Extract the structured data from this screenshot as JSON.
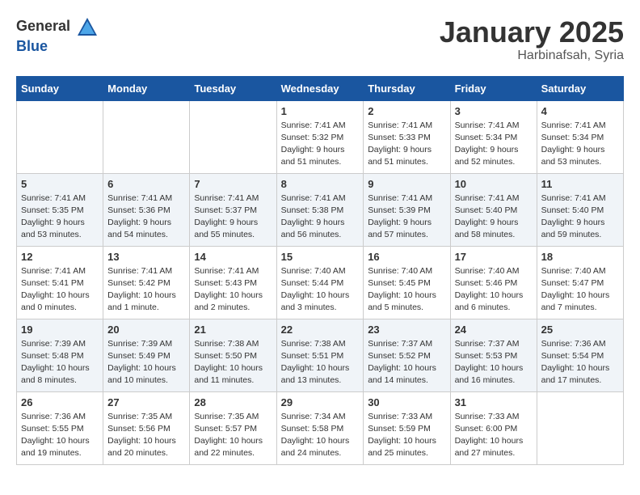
{
  "header": {
    "logo_general": "General",
    "logo_blue": "Blue",
    "month": "January 2025",
    "location": "Harbinafsah, Syria"
  },
  "weekdays": [
    "Sunday",
    "Monday",
    "Tuesday",
    "Wednesday",
    "Thursday",
    "Friday",
    "Saturday"
  ],
  "weeks": [
    [
      {
        "day": "",
        "sunrise": "",
        "sunset": "",
        "daylight": ""
      },
      {
        "day": "",
        "sunrise": "",
        "sunset": "",
        "daylight": ""
      },
      {
        "day": "",
        "sunrise": "",
        "sunset": "",
        "daylight": ""
      },
      {
        "day": "1",
        "sunrise": "Sunrise: 7:41 AM",
        "sunset": "Sunset: 5:32 PM",
        "daylight": "Daylight: 9 hours and 51 minutes."
      },
      {
        "day": "2",
        "sunrise": "Sunrise: 7:41 AM",
        "sunset": "Sunset: 5:33 PM",
        "daylight": "Daylight: 9 hours and 51 minutes."
      },
      {
        "day": "3",
        "sunrise": "Sunrise: 7:41 AM",
        "sunset": "Sunset: 5:34 PM",
        "daylight": "Daylight: 9 hours and 52 minutes."
      },
      {
        "day": "4",
        "sunrise": "Sunrise: 7:41 AM",
        "sunset": "Sunset: 5:34 PM",
        "daylight": "Daylight: 9 hours and 53 minutes."
      }
    ],
    [
      {
        "day": "5",
        "sunrise": "Sunrise: 7:41 AM",
        "sunset": "Sunset: 5:35 PM",
        "daylight": "Daylight: 9 hours and 53 minutes."
      },
      {
        "day": "6",
        "sunrise": "Sunrise: 7:41 AM",
        "sunset": "Sunset: 5:36 PM",
        "daylight": "Daylight: 9 hours and 54 minutes."
      },
      {
        "day": "7",
        "sunrise": "Sunrise: 7:41 AM",
        "sunset": "Sunset: 5:37 PM",
        "daylight": "Daylight: 9 hours and 55 minutes."
      },
      {
        "day": "8",
        "sunrise": "Sunrise: 7:41 AM",
        "sunset": "Sunset: 5:38 PM",
        "daylight": "Daylight: 9 hours and 56 minutes."
      },
      {
        "day": "9",
        "sunrise": "Sunrise: 7:41 AM",
        "sunset": "Sunset: 5:39 PM",
        "daylight": "Daylight: 9 hours and 57 minutes."
      },
      {
        "day": "10",
        "sunrise": "Sunrise: 7:41 AM",
        "sunset": "Sunset: 5:40 PM",
        "daylight": "Daylight: 9 hours and 58 minutes."
      },
      {
        "day": "11",
        "sunrise": "Sunrise: 7:41 AM",
        "sunset": "Sunset: 5:40 PM",
        "daylight": "Daylight: 9 hours and 59 minutes."
      }
    ],
    [
      {
        "day": "12",
        "sunrise": "Sunrise: 7:41 AM",
        "sunset": "Sunset: 5:41 PM",
        "daylight": "Daylight: 10 hours and 0 minutes."
      },
      {
        "day": "13",
        "sunrise": "Sunrise: 7:41 AM",
        "sunset": "Sunset: 5:42 PM",
        "daylight": "Daylight: 10 hours and 1 minute."
      },
      {
        "day": "14",
        "sunrise": "Sunrise: 7:41 AM",
        "sunset": "Sunset: 5:43 PM",
        "daylight": "Daylight: 10 hours and 2 minutes."
      },
      {
        "day": "15",
        "sunrise": "Sunrise: 7:40 AM",
        "sunset": "Sunset: 5:44 PM",
        "daylight": "Daylight: 10 hours and 3 minutes."
      },
      {
        "day": "16",
        "sunrise": "Sunrise: 7:40 AM",
        "sunset": "Sunset: 5:45 PM",
        "daylight": "Daylight: 10 hours and 5 minutes."
      },
      {
        "day": "17",
        "sunrise": "Sunrise: 7:40 AM",
        "sunset": "Sunset: 5:46 PM",
        "daylight": "Daylight: 10 hours and 6 minutes."
      },
      {
        "day": "18",
        "sunrise": "Sunrise: 7:40 AM",
        "sunset": "Sunset: 5:47 PM",
        "daylight": "Daylight: 10 hours and 7 minutes."
      }
    ],
    [
      {
        "day": "19",
        "sunrise": "Sunrise: 7:39 AM",
        "sunset": "Sunset: 5:48 PM",
        "daylight": "Daylight: 10 hours and 8 minutes."
      },
      {
        "day": "20",
        "sunrise": "Sunrise: 7:39 AM",
        "sunset": "Sunset: 5:49 PM",
        "daylight": "Daylight: 10 hours and 10 minutes."
      },
      {
        "day": "21",
        "sunrise": "Sunrise: 7:38 AM",
        "sunset": "Sunset: 5:50 PM",
        "daylight": "Daylight: 10 hours and 11 minutes."
      },
      {
        "day": "22",
        "sunrise": "Sunrise: 7:38 AM",
        "sunset": "Sunset: 5:51 PM",
        "daylight": "Daylight: 10 hours and 13 minutes."
      },
      {
        "day": "23",
        "sunrise": "Sunrise: 7:37 AM",
        "sunset": "Sunset: 5:52 PM",
        "daylight": "Daylight: 10 hours and 14 minutes."
      },
      {
        "day": "24",
        "sunrise": "Sunrise: 7:37 AM",
        "sunset": "Sunset: 5:53 PM",
        "daylight": "Daylight: 10 hours and 16 minutes."
      },
      {
        "day": "25",
        "sunrise": "Sunrise: 7:36 AM",
        "sunset": "Sunset: 5:54 PM",
        "daylight": "Daylight: 10 hours and 17 minutes."
      }
    ],
    [
      {
        "day": "26",
        "sunrise": "Sunrise: 7:36 AM",
        "sunset": "Sunset: 5:55 PM",
        "daylight": "Daylight: 10 hours and 19 minutes."
      },
      {
        "day": "27",
        "sunrise": "Sunrise: 7:35 AM",
        "sunset": "Sunset: 5:56 PM",
        "daylight": "Daylight: 10 hours and 20 minutes."
      },
      {
        "day": "28",
        "sunrise": "Sunrise: 7:35 AM",
        "sunset": "Sunset: 5:57 PM",
        "daylight": "Daylight: 10 hours and 22 minutes."
      },
      {
        "day": "29",
        "sunrise": "Sunrise: 7:34 AM",
        "sunset": "Sunset: 5:58 PM",
        "daylight": "Daylight: 10 hours and 24 minutes."
      },
      {
        "day": "30",
        "sunrise": "Sunrise: 7:33 AM",
        "sunset": "Sunset: 5:59 PM",
        "daylight": "Daylight: 10 hours and 25 minutes."
      },
      {
        "day": "31",
        "sunrise": "Sunrise: 7:33 AM",
        "sunset": "Sunset: 6:00 PM",
        "daylight": "Daylight: 10 hours and 27 minutes."
      },
      {
        "day": "",
        "sunrise": "",
        "sunset": "",
        "daylight": ""
      }
    ]
  ]
}
